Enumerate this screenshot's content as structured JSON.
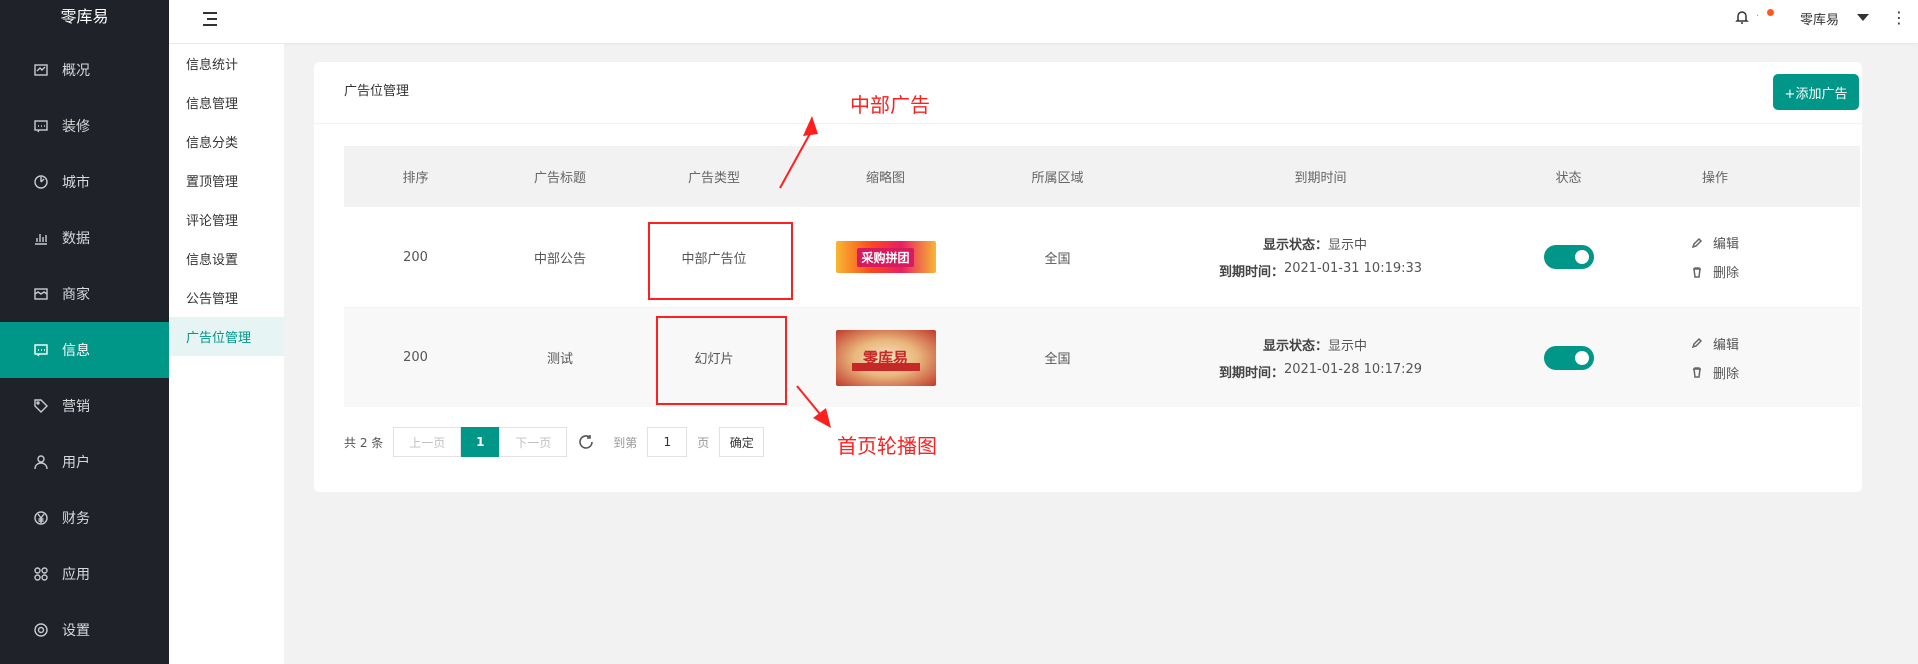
{
  "app": {
    "name": "零库易"
  },
  "sidebar": {
    "items": [
      {
        "label": "概况",
        "icon": "dashboard-icon"
      },
      {
        "label": "装修",
        "icon": "decorate-icon"
      },
      {
        "label": "城市",
        "icon": "city-icon"
      },
      {
        "label": "数据",
        "icon": "chart-icon"
      },
      {
        "label": "商家",
        "icon": "store-icon"
      },
      {
        "label": "信息",
        "icon": "message-icon",
        "active": true
      },
      {
        "label": "营销",
        "icon": "tag-icon"
      },
      {
        "label": "用户",
        "icon": "user-icon"
      },
      {
        "label": "财务",
        "icon": "yen-icon"
      },
      {
        "label": "应用",
        "icon": "apps-icon"
      },
      {
        "label": "设置",
        "icon": "gear-icon"
      }
    ]
  },
  "subnav": {
    "items": [
      {
        "label": "信息统计"
      },
      {
        "label": "信息管理"
      },
      {
        "label": "信息分类"
      },
      {
        "label": "置顶管理"
      },
      {
        "label": "评论管理"
      },
      {
        "label": "信息设置"
      },
      {
        "label": "公告管理"
      },
      {
        "label": "广告位管理",
        "active": true
      }
    ]
  },
  "header": {
    "user": "零库易",
    "dot_sep": "·"
  },
  "card": {
    "title": "广告位管理",
    "add_button": "+添加广告"
  },
  "table": {
    "columns": [
      "排序",
      "广告标题",
      "广告类型",
      "缩略图",
      "所属区域",
      "到期时间",
      "状态",
      "操作"
    ],
    "rows": [
      {
        "order": "200",
        "title": "中部公告",
        "type": "中部广告位",
        "thumb_text": "采购拼团",
        "region": "全国",
        "status_label": "显示状态：",
        "status_value": "显示中",
        "expire_label": "到期时间：",
        "expire_value": "2021-01-31 10:19:33",
        "enabled": true
      },
      {
        "order": "200",
        "title": "测试",
        "type": "幻灯片",
        "thumb_text": "零库易",
        "region": "全国",
        "status_label": "显示状态：",
        "status_value": "显示中",
        "expire_label": "到期时间：",
        "expire_value": "2021-01-28 10:17:29",
        "enabled": true
      }
    ],
    "ops": {
      "edit": "编辑",
      "delete": "删除"
    }
  },
  "pagination": {
    "total": "共 2 条",
    "prev": "上一页",
    "current": "1",
    "next": "下一页",
    "goto_label": "到第",
    "goto_value": "1",
    "unit": "页",
    "confirm": "确定"
  },
  "annotations": {
    "top_label": "中部广告",
    "bottom_label": "首页轮播图",
    "color": "#ff1f1f"
  },
  "colors": {
    "accent": "#009688",
    "sidebar_bg": "#20222a",
    "notify_dot": "#ff5722"
  }
}
